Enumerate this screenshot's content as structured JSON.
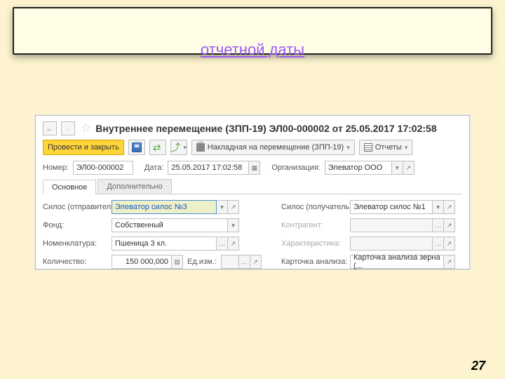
{
  "slide": {
    "banner_subtitle": "отчетной даты",
    "page_number": "27"
  },
  "header": {
    "title": "Внутреннее перемещение (ЗПП-19) ЭЛ00-000002 от 25.05.2017 17:02:58"
  },
  "toolbar": {
    "submit_label": "Провести и закрыть",
    "print_label": "Накладная на перемещение (ЗПП-19)",
    "reports_label": "Отчеты"
  },
  "form": {
    "number_label": "Номер:",
    "number_value": "ЭЛ00-000002",
    "date_label": "Дата:",
    "date_value": "25.05.2017 17:02:58",
    "org_label": "Организация:",
    "org_value": "Элеватор ООО"
  },
  "tabs": {
    "main": "Основное",
    "extra": "Дополнительно"
  },
  "main": {
    "silo_from_label": "Силос (отправитель):",
    "silo_from_value": "Элеватор силос №3",
    "silo_to_label": "Силос (получатель):",
    "silo_to_value": "Элеватор силос №1",
    "fund_label": "Фонд:",
    "fund_value": "Собственный",
    "counterparty_label": "Контрагент:",
    "nomenclature_label": "Номенклатура:",
    "nomenclature_value": "Пшеница 3 кл.",
    "characteristic_label": "Характеристика:",
    "qty_label": "Количество:",
    "qty_value": "150 000,000",
    "uom_label": "Ед.изм.:",
    "card_label": "Карточка анализа:",
    "card_value": "Карточка анализа зерна (..."
  }
}
